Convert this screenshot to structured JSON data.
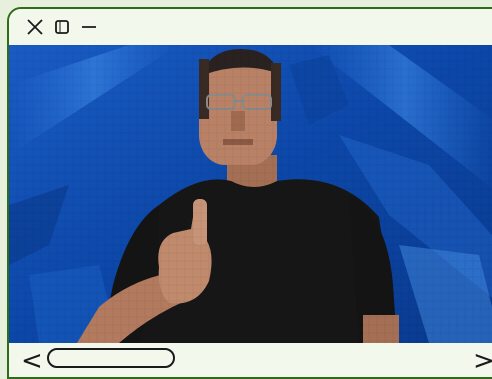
{
  "window": {
    "controls": {
      "close_icon": "close-icon",
      "maximize_icon": "maximize-icon",
      "minimize_icon": "minimize-icon"
    },
    "content": {
      "description_icon": "video-frame",
      "colors": {
        "background_blue": "#0d4fb5",
        "shirt": "#161616",
        "skin": "#b07a5d"
      }
    },
    "scrollbar": {
      "left_arrow": "<",
      "right_arrow": ">",
      "thumb_position": 0.0
    },
    "colors": {
      "border": "#2e6b1a",
      "frame_bg": "#f3f8ec",
      "outer_bg": "#e6f0dc"
    }
  }
}
